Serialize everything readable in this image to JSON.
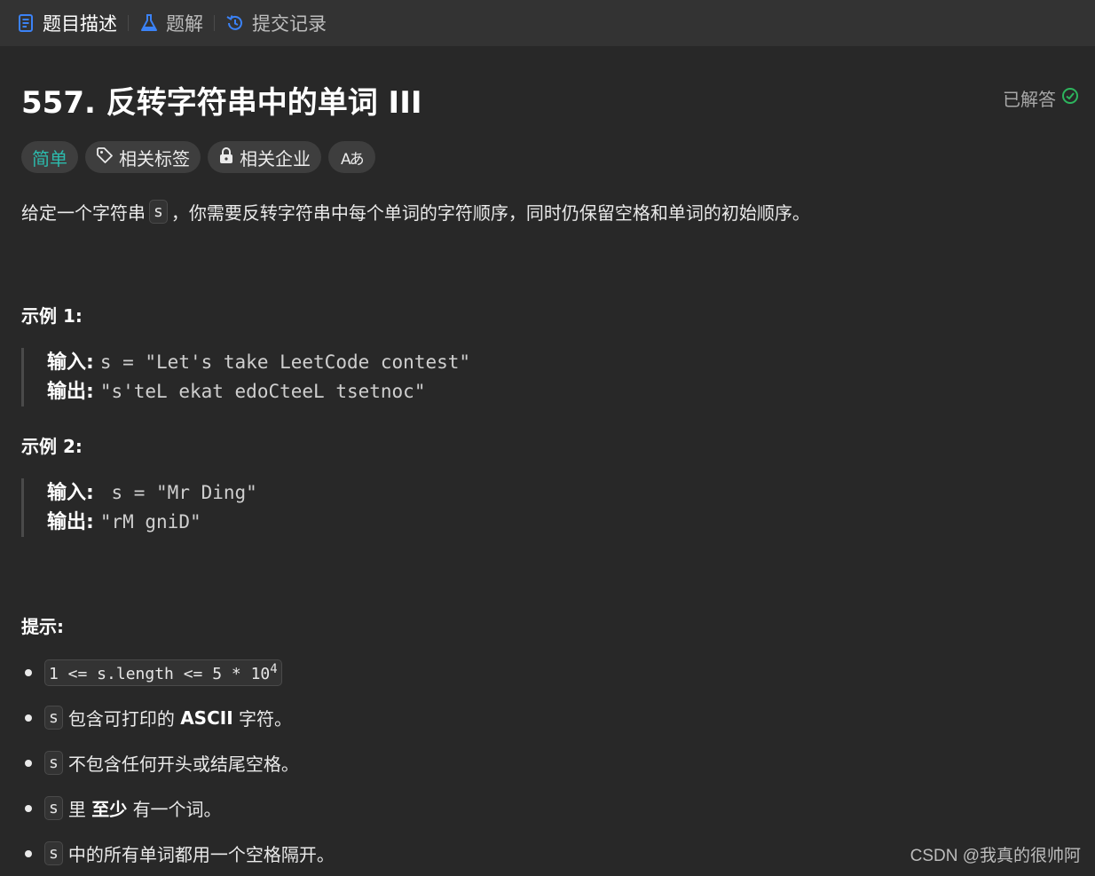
{
  "tabs": [
    {
      "label": "题目描述",
      "active": true
    },
    {
      "label": "题解",
      "active": false
    },
    {
      "label": "提交记录",
      "active": false
    }
  ],
  "problem": {
    "title": "557. 反转字符串中的单词 III",
    "status": "已解答",
    "tags": {
      "difficulty": "简单",
      "related_tags": "相关标签",
      "related_companies": "相关企业",
      "translate": "Aあ"
    },
    "description": {
      "part1": "给定一个字符串",
      "code": "s",
      "part2": "，你需要反转字符串中每个单词的字符顺序，同时仍保留空格和单词的初始顺序。"
    },
    "examples": [
      {
        "heading": "示例 1:",
        "input_label": "输入:",
        "input": "s = \"Let's take LeetCode contest\"",
        "output_label": "输出:",
        "output": "\"s'teL ekat edoCteeL tsetnoc\""
      },
      {
        "heading": "示例 2:",
        "input_label": "输入:",
        "input": " s = \"Mr Ding\"",
        "output_label": "输出:",
        "output": "\"rM gniD\""
      }
    ],
    "hints_heading": "提示:",
    "hints": {
      "h1_code": "1 <= s.length <= 5 * 10",
      "h1_sup": "4",
      "h2_code": "s",
      "h2_a": "包含可打印的",
      "h2_b": "ASCII",
      "h2_c": "字符。",
      "h3_code": "s",
      "h3_a": "不包含任何开头或结尾空格。",
      "h4_code": "s",
      "h4_a": "里",
      "h4_b": "至少",
      "h4_c": "有一个词。",
      "h5_code": "s",
      "h5_a": "中的所有单词都用一个空格隔开。"
    }
  },
  "watermark": "CSDN @我真的很帅阿",
  "colors": {
    "background": "#282828",
    "tabbar": "#333333",
    "easy": "#2cbbad",
    "solved_check": "#2db55d",
    "tab_icon_blue": "#3b82f6"
  }
}
